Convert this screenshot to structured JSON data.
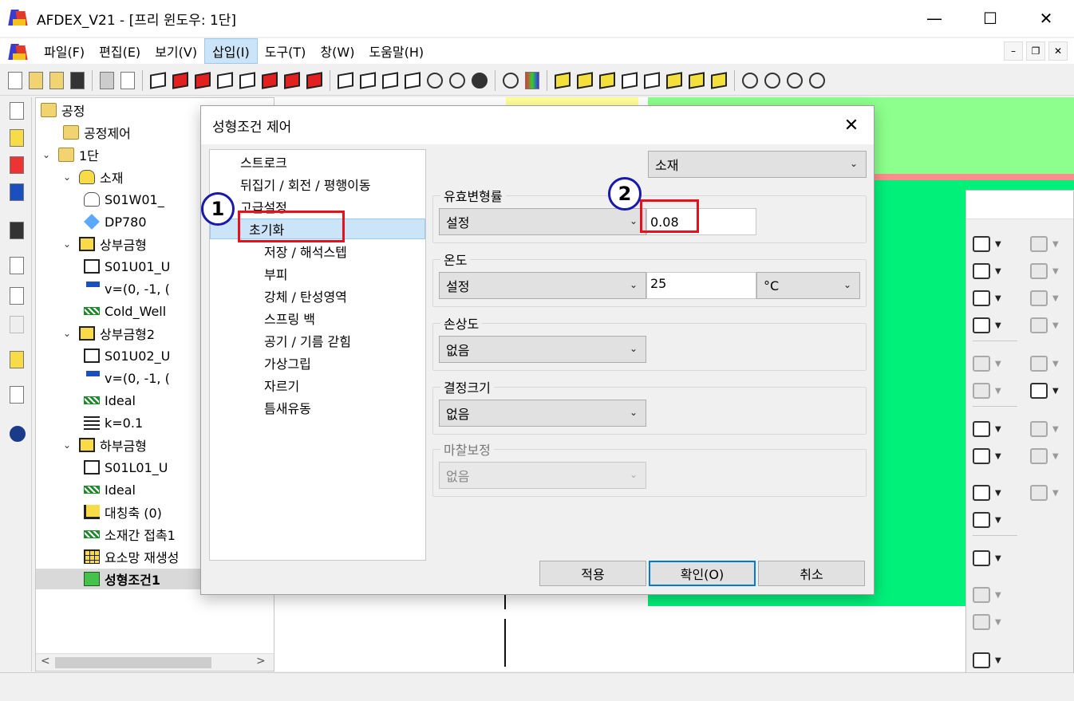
{
  "window": {
    "title": "AFDEX_V21 - [프리 윈도우: 1단]",
    "min": "—",
    "max": "☐",
    "close": "✕"
  },
  "menu": {
    "items": [
      "파일(F)",
      "편집(E)",
      "보기(V)",
      "삽입(I)",
      "도구(T)",
      "창(W)",
      "도움말(H)"
    ],
    "active_index": 3,
    "mdi": [
      "–",
      "❐",
      "✕"
    ]
  },
  "tree": {
    "nodes": [
      {
        "label": "공정",
        "chev": "",
        "icon": "folder"
      },
      {
        "label": "공정제어",
        "chev": "",
        "icon": "folder"
      },
      {
        "label": "1단",
        "chev": "⌄",
        "icon": "folder"
      },
      {
        "label": "소재",
        "chev": "⌄",
        "icon": "cyl"
      },
      {
        "label": "S01W01_",
        "chev": "",
        "icon": "cylw"
      },
      {
        "label": "DP780",
        "chev": "",
        "icon": "gem"
      },
      {
        "label": "상부금형",
        "chev": "⌄",
        "icon": "die"
      },
      {
        "label": "S01U01_U",
        "chev": "",
        "icon": "dieW"
      },
      {
        "label": "v=(0, -1, (",
        "chev": "",
        "icon": "hammer"
      },
      {
        "label": "Cold_Well",
        "chev": "",
        "icon": "hatch"
      },
      {
        "label": "상부금형2",
        "chev": "⌄",
        "icon": "die"
      },
      {
        "label": "S01U02_U",
        "chev": "",
        "icon": "dieW"
      },
      {
        "label": "v=(0, -1, (",
        "chev": "",
        "icon": "hammer"
      },
      {
        "label": "Ideal",
        "chev": "",
        "icon": "hatch"
      },
      {
        "label": "k=0.1",
        "chev": "",
        "icon": "spring"
      },
      {
        "label": "하부금형",
        "chev": "⌄",
        "icon": "die"
      },
      {
        "label": "S01L01_U",
        "chev": "",
        "icon": "dieW"
      },
      {
        "label": "Ideal",
        "chev": "",
        "icon": "hatch"
      },
      {
        "label": "대칭축 (0)",
        "chev": "",
        "icon": "sym"
      },
      {
        "label": "소재간 접촉1",
        "chev": "",
        "icon": "hatch"
      },
      {
        "label": "요소망 재생성",
        "chev": "",
        "icon": "grid"
      },
      {
        "label": "성형조건1",
        "chev": "",
        "icon": "clip"
      }
    ],
    "selected_index": 21,
    "scroll_left": "<",
    "scroll_right": ">"
  },
  "dialog": {
    "title": "성형조건 제어",
    "close": "✕",
    "tree": [
      {
        "label": "스트로크",
        "level": 0
      },
      {
        "label": "뒤집기 / 회전 / 평행이동",
        "level": 0
      },
      {
        "label": "고급설정",
        "level": 0
      },
      {
        "label": "초기화",
        "level": 1,
        "selected": true
      },
      {
        "label": "저장 / 해석스텝",
        "level": 1
      },
      {
        "label": "부피",
        "level": 1
      },
      {
        "label": "강체 / 탄성영역",
        "level": 1
      },
      {
        "label": "스프링 백",
        "level": 1
      },
      {
        "label": "공기 / 기름 갇힘",
        "level": 1
      },
      {
        "label": "가상그립",
        "level": 1
      },
      {
        "label": "자르기",
        "level": 1
      },
      {
        "label": "틈새유동",
        "level": 1
      }
    ],
    "target_select": "소재",
    "effective_strain": {
      "label": "유효변형률",
      "mode": "설정",
      "value": "0.08"
    },
    "temperature": {
      "label": "온도",
      "mode": "설정",
      "value": "25",
      "unit": "°C"
    },
    "damage": {
      "label": "손상도",
      "value": "없음"
    },
    "grain_size": {
      "label": "결정크기",
      "value": "없음"
    },
    "friction_correction": {
      "label": "마찰보정",
      "value": "없음"
    },
    "buttons": {
      "apply": "적용",
      "ok": "확인(O)",
      "cancel": "취소"
    },
    "dropdown_arrow": "⌄"
  },
  "annotations": {
    "badge1": "1",
    "badge2": "2",
    "annotation_color": "#e8101a",
    "badge_color": "#1a1aaa"
  },
  "colors": {
    "viewport_green": "#00f07a",
    "viewport_light_green": "#8cff8c",
    "viewport_pink": "#ff8c8c",
    "selection": "#cce4f7"
  }
}
